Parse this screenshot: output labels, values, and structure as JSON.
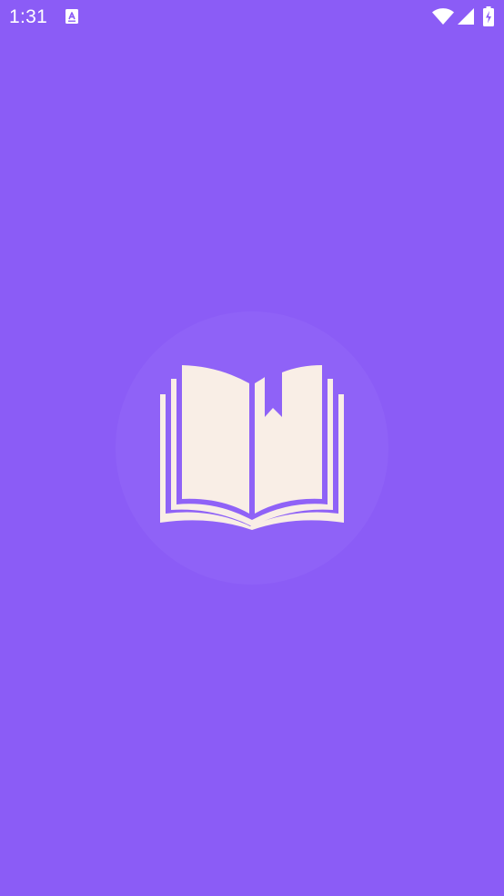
{
  "status_bar": {
    "time": "1:31",
    "notification_icon": "app-notification-icon",
    "wifi_icon": "wifi-icon",
    "signal_icon": "cellular-signal-icon",
    "battery_icon": "battery-charging-icon"
  },
  "splash": {
    "logo_icon": "open-book-bookmark-icon"
  },
  "colors": {
    "background": "#8B5CF6",
    "logo_glow": "#8F62F7",
    "logo_fill": "#F9EEE6",
    "status_text": "#FFFFFF"
  }
}
